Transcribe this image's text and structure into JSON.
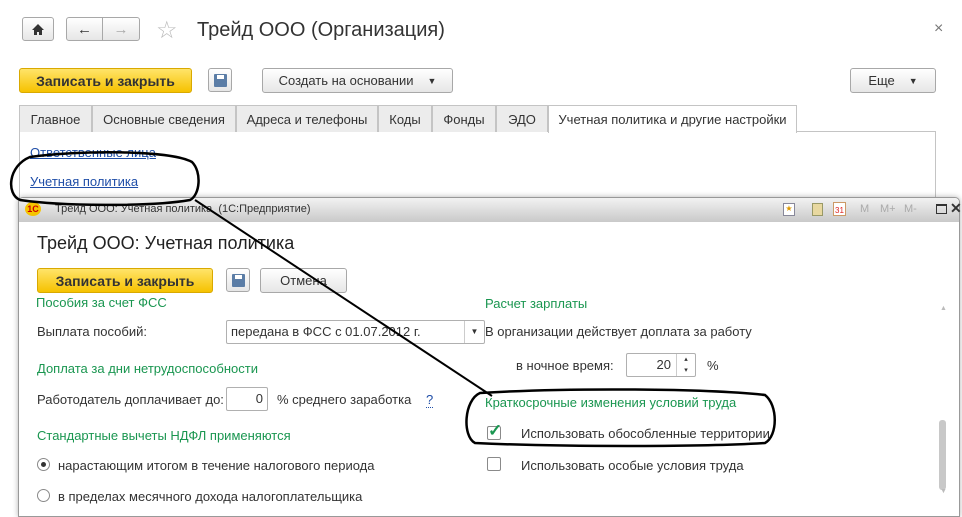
{
  "main_window": {
    "title": "Трейд ООО (Организация)",
    "close": "×",
    "save_close": "Записать и закрыть",
    "create_based": "Создать на основании",
    "more": "Еще",
    "tabs": [
      {
        "label": "Главное"
      },
      {
        "label": "Основные сведения"
      },
      {
        "label": "Адреса и телефоны"
      },
      {
        "label": "Коды"
      },
      {
        "label": "Фонды"
      },
      {
        "label": "ЭДО"
      },
      {
        "label": "Учетная политика и другие настройки",
        "active": true
      }
    ],
    "links": [
      "Ответственные лица",
      "Учетная политика"
    ]
  },
  "sub_window": {
    "caption": "Трейд ООО: Учетная политика  (1С:Предприятие)",
    "toolbar": {
      "m": "M",
      "m_plus": "M+",
      "m_minus": "M-"
    },
    "title": "Трейд ООО: Учетная политика",
    "save_close": "Записать и закрыть",
    "cancel": "Отмена",
    "left": {
      "section_fss": "Пособия за счет ФСС",
      "payment_label": "Выплата пособий:",
      "payment_value": "передана в ФСС с 01.07.2012 г.",
      "section_sick": "Доплата за дни нетрудоспособности",
      "employer_label": "Работодатель доплачивает до:",
      "employer_value": "0",
      "employer_suffix": "% среднего заработка",
      "help": "?",
      "section_ndfl": "Стандартные вычеты НДФЛ применяются",
      "radio1": "нарастающим итогом в течение налогового периода",
      "radio2": "в пределах месячного дохода налогоплательщика",
      "radio_selected": 1
    },
    "right": {
      "section_salary": "Расчет зарплаты",
      "night_text": "В организации действует доплата за работу",
      "night_label": "в ночное время:",
      "night_value": "20",
      "night_unit": "%",
      "section_short": "Краткосрочные изменения условий труда",
      "chk1": "Использовать обособленные территории",
      "chk1_checked": true,
      "chk2": "Использовать особые условия труда",
      "chk2_checked": false
    }
  },
  "colors": {
    "accent_yellow": "#f6c200",
    "section_green": "#1a9650",
    "link_blue": "#1f4ea8"
  }
}
